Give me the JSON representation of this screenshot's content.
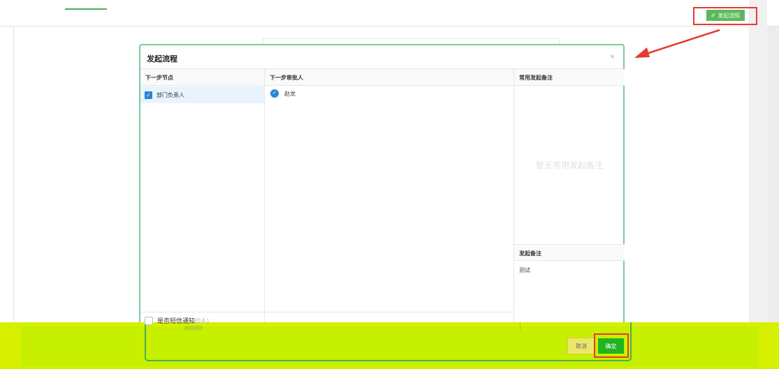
{
  "toolbar": {
    "start_button_label": "发起流程",
    "start_button_icon": "send-icon"
  },
  "modal": {
    "title": "发起流程",
    "close_symbol": "×",
    "columns": {
      "next_node_header": "下一步节点",
      "next_approver_header": "下一步审批人",
      "common_remark_header": "常用发起备注",
      "remark_header": "发起备注"
    },
    "next_nodes": [
      {
        "label": "部门负责人",
        "checked": true
      }
    ],
    "approvers": [
      {
        "name": "赵龙",
        "selected": true
      }
    ],
    "common_remark_empty": "暂无常用发起备注",
    "remark_value": "测试",
    "sms_notify_label": "是否短信通知",
    "sms_notify_suffix": "(0人)",
    "cancel_label": "取消",
    "confirm_label": "确定"
  },
  "colors": {
    "accent_green": "#21b321",
    "highlight_red": "#e53935",
    "check_blue": "#2b84d8",
    "overlay_yellow_green": "#d6f000"
  }
}
